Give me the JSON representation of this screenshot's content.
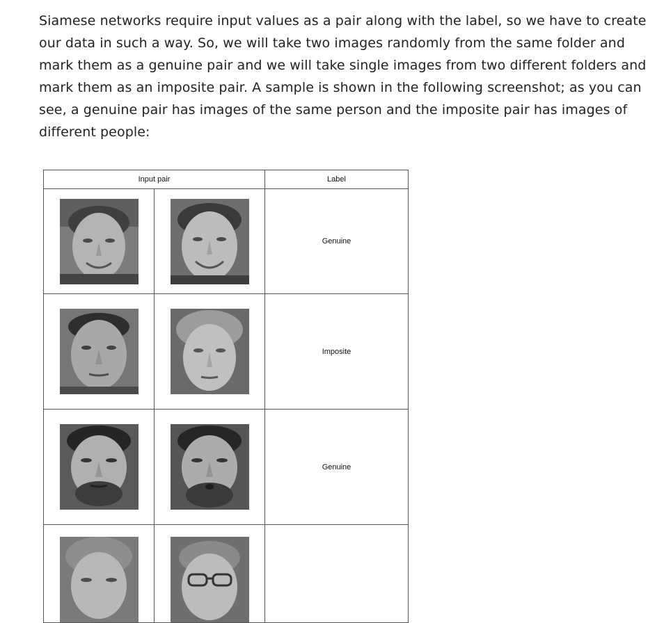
{
  "paragraph": "Siamese networks require input values as a pair along with the label, so we have to create our data in such a way. So, we will take two images randomly from the same folder and mark them as a genuine pair and we will take single images from two different folders and mark them as an imposite pair. A sample is shown in the following screenshot; as you can see, a genuine pair has images of the same person and the imposite pair has images of different people:",
  "table": {
    "headers": {
      "input_pair": "Input pair",
      "label": "Label"
    },
    "rows": [
      {
        "label": "Genuine",
        "left_face": "face-photo-young-man-smiling",
        "right_face": "face-photo-young-man-smiling"
      },
      {
        "label": "Imposite",
        "left_face": "face-photo-man-short-hair",
        "right_face": "face-photo-man-light-hair"
      },
      {
        "label": "Genuine",
        "left_face": "face-photo-bearded-man",
        "right_face": "face-photo-bearded-man"
      },
      {
        "label": "",
        "left_face": "face-photo-man-partial",
        "right_face": "face-photo-man-glasses-partial"
      }
    ]
  }
}
